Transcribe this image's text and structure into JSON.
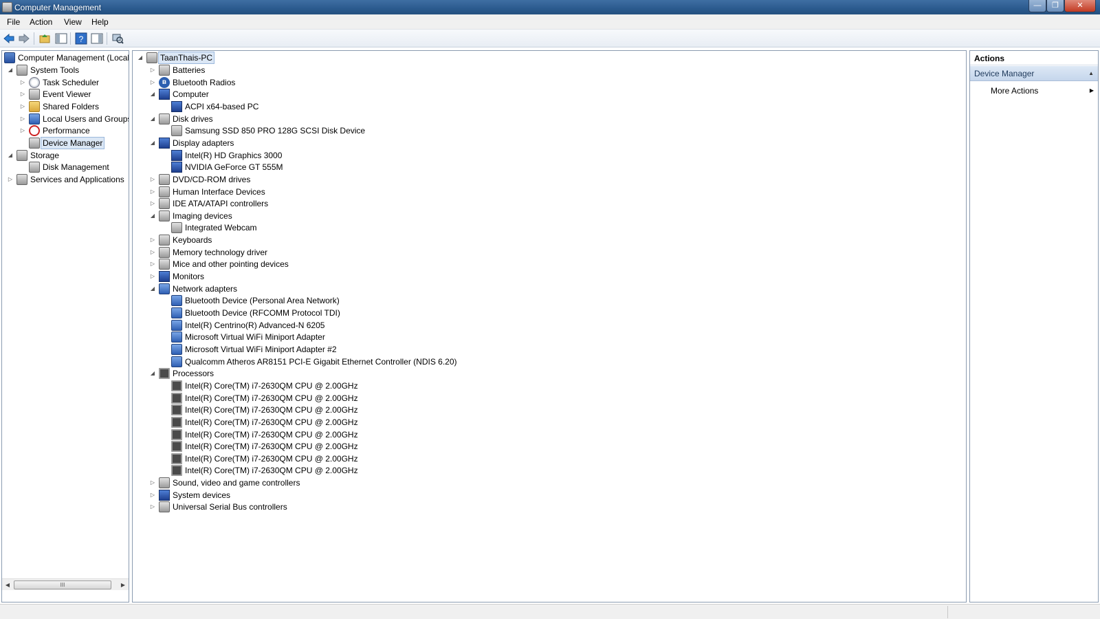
{
  "window": {
    "title": "Computer Management"
  },
  "menu": {
    "file": "File",
    "action": "Action",
    "view": "View",
    "help": "Help"
  },
  "left_tree": {
    "root": "Computer Management (Local",
    "system_tools": "System Tools",
    "task_scheduler": "Task Scheduler",
    "event_viewer": "Event Viewer",
    "shared_folders": "Shared Folders",
    "local_users": "Local Users and Groups",
    "performance": "Performance",
    "device_manager": "Device Manager",
    "storage": "Storage",
    "disk_management": "Disk Management",
    "services_apps": "Services and Applications",
    "scroll_grip": "III"
  },
  "device_tree": {
    "root": "TaanThais-PC",
    "items": [
      {
        "label": "Batteries",
        "level": 1,
        "icon": "battery-icon",
        "expander": "collapsed"
      },
      {
        "label": "Bluetooth Radios",
        "level": 1,
        "icon": "bluetooth-icon",
        "expander": "collapsed"
      },
      {
        "label": "Computer",
        "level": 1,
        "icon": "computer-icon",
        "expander": "expanded"
      },
      {
        "label": "ACPI x64-based PC",
        "level": 2,
        "icon": "computer-icon",
        "expander": "none"
      },
      {
        "label": "Disk drives",
        "level": 1,
        "icon": "disk-drive-icon",
        "expander": "expanded"
      },
      {
        "label": "Samsung SSD 850 PRO 128G SCSI Disk Device",
        "level": 2,
        "icon": "disk-drive-icon",
        "expander": "none"
      },
      {
        "label": "Display adapters",
        "level": 1,
        "icon": "display-adapter-icon",
        "expander": "expanded"
      },
      {
        "label": "Intel(R) HD Graphics 3000",
        "level": 2,
        "icon": "display-adapter-icon",
        "expander": "none"
      },
      {
        "label": "NVIDIA GeForce GT 555M",
        "level": 2,
        "icon": "display-adapter-icon",
        "expander": "none"
      },
      {
        "label": "DVD/CD-ROM drives",
        "level": 1,
        "icon": "dvd-drive-icon",
        "expander": "collapsed"
      },
      {
        "label": "Human Interface Devices",
        "level": 1,
        "icon": "hid-icon",
        "expander": "collapsed"
      },
      {
        "label": "IDE ATA/ATAPI controllers",
        "level": 1,
        "icon": "ide-controller-icon",
        "expander": "collapsed"
      },
      {
        "label": "Imaging devices",
        "level": 1,
        "icon": "imaging-device-icon",
        "expander": "expanded"
      },
      {
        "label": "Integrated Webcam",
        "level": 2,
        "icon": "webcam-icon",
        "expander": "none"
      },
      {
        "label": "Keyboards",
        "level": 1,
        "icon": "keyboard-icon",
        "expander": "collapsed"
      },
      {
        "label": "Memory technology driver",
        "level": 1,
        "icon": "memory-icon",
        "expander": "collapsed"
      },
      {
        "label": "Mice and other pointing devices",
        "level": 1,
        "icon": "mouse-icon",
        "expander": "collapsed"
      },
      {
        "label": "Monitors",
        "level": 1,
        "icon": "monitor-icon",
        "expander": "collapsed"
      },
      {
        "label": "Network adapters",
        "level": 1,
        "icon": "network-adapter-icon",
        "expander": "expanded"
      },
      {
        "label": "Bluetooth Device (Personal Area Network)",
        "level": 2,
        "icon": "network-adapter-icon",
        "expander": "none"
      },
      {
        "label": "Bluetooth Device (RFCOMM Protocol TDI)",
        "level": 2,
        "icon": "network-adapter-icon",
        "expander": "none"
      },
      {
        "label": "Intel(R) Centrino(R) Advanced-N 6205",
        "level": 2,
        "icon": "network-adapter-icon",
        "expander": "none"
      },
      {
        "label": "Microsoft Virtual WiFi Miniport Adapter",
        "level": 2,
        "icon": "network-adapter-icon",
        "expander": "none"
      },
      {
        "label": "Microsoft Virtual WiFi Miniport Adapter #2",
        "level": 2,
        "icon": "network-adapter-icon",
        "expander": "none"
      },
      {
        "label": "Qualcomm Atheros AR8151 PCI-E Gigabit Ethernet Controller (NDIS 6.20)",
        "level": 2,
        "icon": "network-adapter-icon",
        "expander": "none"
      },
      {
        "label": "Processors",
        "level": 1,
        "icon": "processor-icon",
        "expander": "expanded"
      },
      {
        "label": "Intel(R) Core(TM) i7-2630QM CPU @ 2.00GHz",
        "level": 2,
        "icon": "processor-icon",
        "expander": "none"
      },
      {
        "label": "Intel(R) Core(TM) i7-2630QM CPU @ 2.00GHz",
        "level": 2,
        "icon": "processor-icon",
        "expander": "none"
      },
      {
        "label": "Intel(R) Core(TM) i7-2630QM CPU @ 2.00GHz",
        "level": 2,
        "icon": "processor-icon",
        "expander": "none"
      },
      {
        "label": "Intel(R) Core(TM) i7-2630QM CPU @ 2.00GHz",
        "level": 2,
        "icon": "processor-icon",
        "expander": "none"
      },
      {
        "label": "Intel(R) Core(TM) i7-2630QM CPU @ 2.00GHz",
        "level": 2,
        "icon": "processor-icon",
        "expander": "none"
      },
      {
        "label": "Intel(R) Core(TM) i7-2630QM CPU @ 2.00GHz",
        "level": 2,
        "icon": "processor-icon",
        "expander": "none"
      },
      {
        "label": "Intel(R) Core(TM) i7-2630QM CPU @ 2.00GHz",
        "level": 2,
        "icon": "processor-icon",
        "expander": "none"
      },
      {
        "label": "Intel(R) Core(TM) i7-2630QM CPU @ 2.00GHz",
        "level": 2,
        "icon": "processor-icon",
        "expander": "none"
      },
      {
        "label": "Sound, video and game controllers",
        "level": 1,
        "icon": "sound-icon",
        "expander": "collapsed"
      },
      {
        "label": "System devices",
        "level": 1,
        "icon": "system-device-icon",
        "expander": "collapsed"
      },
      {
        "label": "Universal Serial Bus controllers",
        "level": 1,
        "icon": "usb-icon",
        "expander": "collapsed"
      }
    ]
  },
  "actions": {
    "header": "Actions",
    "section": "Device Manager",
    "more": "More Actions"
  }
}
